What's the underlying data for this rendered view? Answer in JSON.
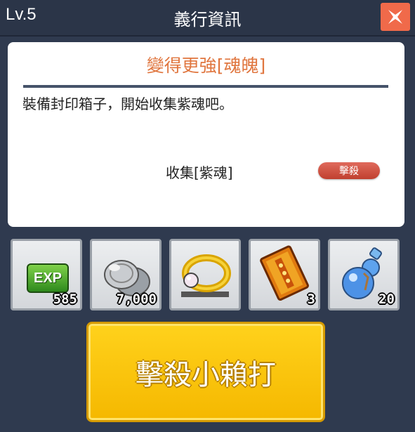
{
  "header": {
    "level": "Lv.5",
    "title": "義行資訊"
  },
  "quest": {
    "title": "變得更強[魂魄]",
    "description": "裝備封印箱子，開始收集紫魂吧。",
    "objective": "收集[紫魂]",
    "action_label": "擊殺"
  },
  "rewards": [
    {
      "name": "EXP",
      "icon": "exp-icon",
      "qty": "585"
    },
    {
      "name": "coins",
      "icon": "coins-icon",
      "qty": "7,000"
    },
    {
      "name": "ring",
      "icon": "ring-icon",
      "qty": ""
    },
    {
      "name": "scroll",
      "icon": "scroll-book-icon",
      "qty": "3"
    },
    {
      "name": "potion",
      "icon": "gourd-potion-icon",
      "qty": "20"
    }
  ],
  "main_button": {
    "label": "擊殺小賴打"
  },
  "colors": {
    "accent": "#e0763f",
    "close": "#f06a4a",
    "button": "#f5b800"
  }
}
